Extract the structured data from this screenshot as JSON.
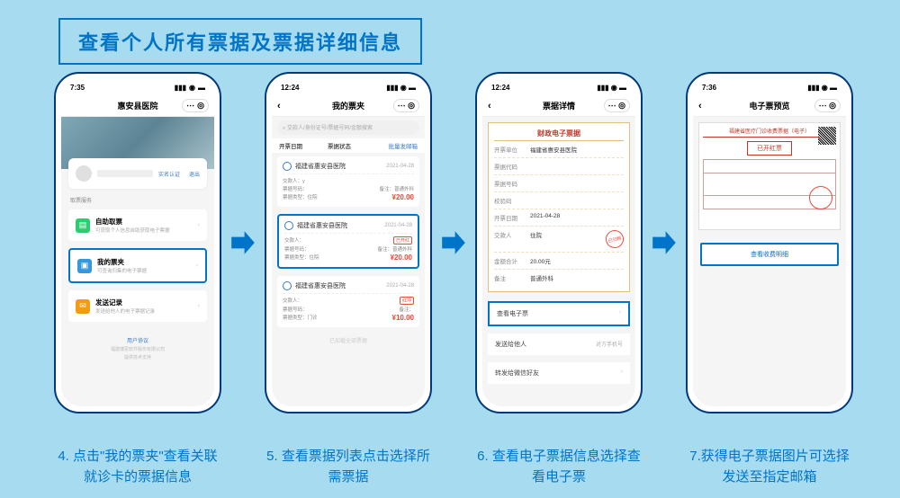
{
  "title": "查看个人所有票据及票据详细信息",
  "phone1": {
    "time": "7:35",
    "nav_title": "惠安县医院",
    "verify": "实名认证",
    "logout": "退出",
    "section": "取票服务",
    "menu": [
      {
        "title": "自助取票",
        "sub": "可获取个人信息自助获取电子票据"
      },
      {
        "title": "我的票夹",
        "sub": "可查询归集的电子票据"
      },
      {
        "title": "发送记录",
        "sub": "发送给他人的电子票据记录"
      }
    ],
    "footer1": "用户协议",
    "footer2": "福建博思软件股份有限公司",
    "footer3": "提供技术支持"
  },
  "phone2": {
    "time": "12:24",
    "nav_title": "我的票夹",
    "search_placeholder": "交款人/身份证号/票据号码/金额搜索",
    "filters": {
      "f1": "开票日期",
      "f2": "票据状态",
      "f3": "批量发邮箱"
    },
    "bills": [
      {
        "unit": "福建省惠安县医院",
        "date": "2021-04-28",
        "payer": "交款人：y",
        "code": "票据号码：",
        "remark": "备注：普通外科",
        "type": "票据类型：住院",
        "amount": "¥20.00"
      },
      {
        "unit": "福建省惠安县医院",
        "date": "2021-04-28",
        "payer": "交款人：",
        "code": "票据号码：",
        "remark": "备注：普通外科",
        "type": "票据类型：住院",
        "amount": "¥20.00",
        "tag": "已开红"
      },
      {
        "unit": "福建省惠安县医院",
        "date": "2021-04-28",
        "payer": "交款人：",
        "code": "票据号码：",
        "remark": "备注：",
        "type": "票据类型：门诊",
        "amount": "¥10.00",
        "tag": "红冲"
      }
    ],
    "end": "已加载全部票据"
  },
  "phone3": {
    "time": "12:24",
    "nav_title": "票据详情",
    "receipt_title": "财政电子票据",
    "fields": {
      "unit_l": "开票单位",
      "unit_v": "福建省惠安县医院",
      "code_l": "票据代码",
      "code_v": "",
      "no_l": "票据号码",
      "no_v": "",
      "check_l": "校验码",
      "check_v": "",
      "date_l": "开票日期",
      "date_v": "2021-04-28",
      "payer_l": "交款人",
      "payer_v": "住院",
      "amount_l": "金额合计",
      "amount_v": "20.00元",
      "remark_l": "备注",
      "remark_v": "普通外科"
    },
    "stamp": "已归档",
    "action1": "查看电子票",
    "action2": "发送给他人",
    "action2_sub": "对方手机号",
    "action3": "转发给微信好友"
  },
  "phone4": {
    "time": "7:36",
    "nav_title": "电子票预览",
    "invoice_head": "福建省医疗门诊收费票据（电子）",
    "redtag": "已开红票",
    "button": "查看收费明细"
  },
  "captions": [
    "4. 点击\"我的票夹\"查看关联就诊卡的票据信息",
    "5. 查看票据列表点击选择所需票据",
    "6. 查看电子票据信息选择查看电子票",
    "7.获得电子票据图片可选择发送至指定邮箱"
  ]
}
